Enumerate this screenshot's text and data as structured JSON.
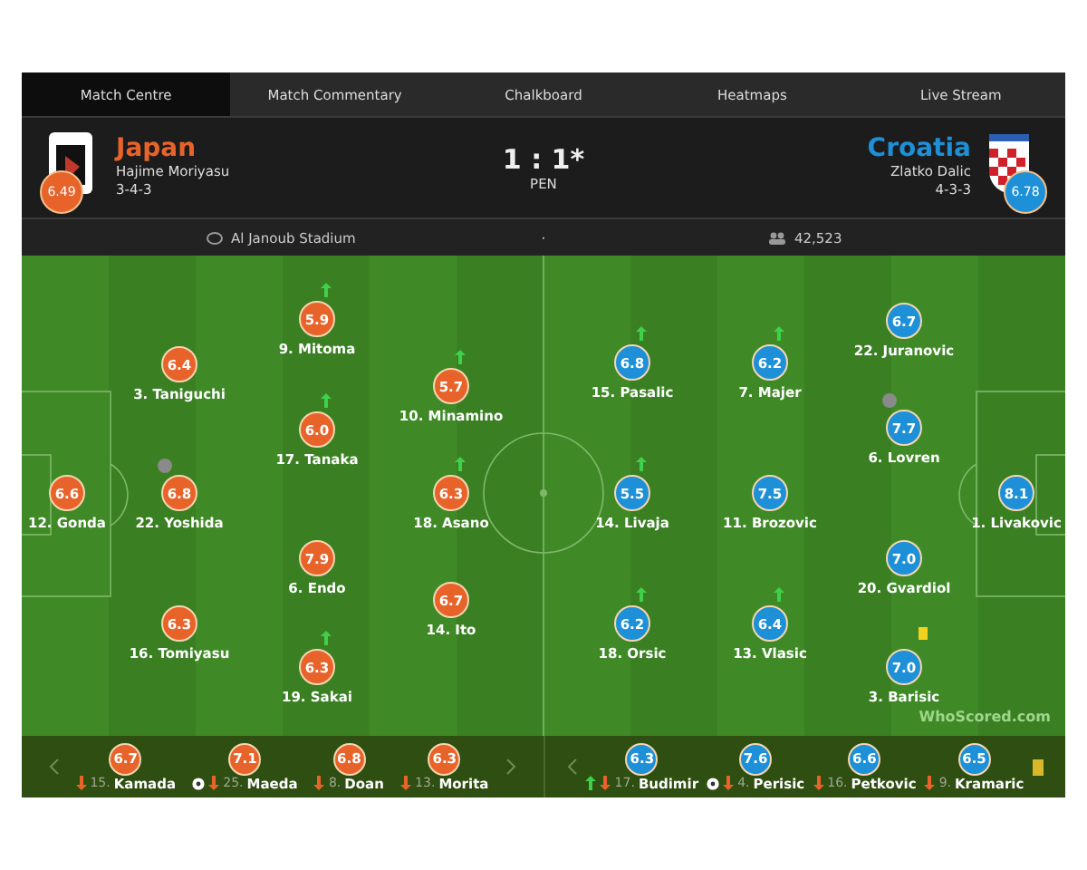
{
  "tabs": [
    {
      "label": "Match Centre",
      "selected": true
    },
    {
      "label": "Match Commentary",
      "selected": false
    },
    {
      "label": "Chalkboard",
      "selected": false
    },
    {
      "label": "Heatmaps",
      "selected": false
    },
    {
      "label": "Live Stream",
      "selected": false
    }
  ],
  "home": {
    "name": "Japan",
    "manager": "Hajime Moriyasu",
    "formation": "3-4-3",
    "rating": "6.49",
    "color": "#e8632a"
  },
  "away": {
    "name": "Croatia",
    "manager": "Zlatko Dalic",
    "formation": "4-3-3",
    "rating": "6.78",
    "color": "#1e90d8"
  },
  "score": "1 : 1*",
  "score_note": "PEN",
  "info": {
    "stadium": "Al Janoub Stadium",
    "separator": "·",
    "attendance": "42,523"
  },
  "home_players": [
    {
      "label": "12. Gonda",
      "rating": "6.6",
      "sub_on": false,
      "captain": false,
      "yellow_card": false
    },
    {
      "label": "3. Taniguchi",
      "rating": "6.4",
      "sub_on": false,
      "captain": false,
      "yellow_card": false
    },
    {
      "label": "22. Yoshida",
      "rating": "6.8",
      "sub_on": false,
      "captain": true,
      "yellow_card": false
    },
    {
      "label": "16. Tomiyasu",
      "rating": "6.3",
      "sub_on": false,
      "captain": false,
      "yellow_card": false
    },
    {
      "label": "9. Mitoma",
      "rating": "5.9",
      "sub_on": true,
      "captain": false,
      "yellow_card": false
    },
    {
      "label": "17. Tanaka",
      "rating": "6.0",
      "sub_on": true,
      "captain": false,
      "yellow_card": false
    },
    {
      "label": "6. Endo",
      "rating": "7.9",
      "sub_on": false,
      "captain": false,
      "yellow_card": false
    },
    {
      "label": "19. Sakai",
      "rating": "6.3",
      "sub_on": true,
      "captain": false,
      "yellow_card": false
    },
    {
      "label": "10. Minamino",
      "rating": "5.7",
      "sub_on": true,
      "captain": false,
      "yellow_card": false
    },
    {
      "label": "18. Asano",
      "rating": "6.3",
      "sub_on": true,
      "captain": false,
      "yellow_card": false
    },
    {
      "label": "14. Ito",
      "rating": "6.7",
      "sub_on": false,
      "captain": false,
      "yellow_card": false
    }
  ],
  "away_players": [
    {
      "label": "15. Pasalic",
      "rating": "6.8",
      "sub_on": true,
      "captain": false,
      "yellow_card": false
    },
    {
      "label": "7. Majer",
      "rating": "6.2",
      "sub_on": true,
      "captain": false,
      "yellow_card": false
    },
    {
      "label": "22. Juranovic",
      "rating": "6.7",
      "sub_on": false,
      "captain": false,
      "yellow_card": false
    },
    {
      "label": "6. Lovren",
      "rating": "7.7",
      "sub_on": false,
      "captain": true,
      "yellow_card": false
    },
    {
      "label": "14. Livaja",
      "rating": "5.5",
      "sub_on": true,
      "captain": false,
      "yellow_card": false
    },
    {
      "label": "11. Brozovic",
      "rating": "7.5",
      "sub_on": false,
      "captain": false,
      "yellow_card": false
    },
    {
      "label": "1. Livakovic",
      "rating": "8.1",
      "sub_on": false,
      "captain": false,
      "yellow_card": false
    },
    {
      "label": "20. Gvardiol",
      "rating": "7.0",
      "sub_on": false,
      "captain": false,
      "yellow_card": false
    },
    {
      "label": "18. Orsic",
      "rating": "6.2",
      "sub_on": true,
      "captain": false,
      "yellow_card": false
    },
    {
      "label": "13. Vlasic",
      "rating": "6.4",
      "sub_on": true,
      "captain": false,
      "yellow_card": false
    },
    {
      "label": "3. Barisic",
      "rating": "7.0",
      "sub_on": false,
      "captain": false,
      "yellow_card": true
    }
  ],
  "watermark_logo": "WhoScored.com",
  "home_bench": [
    {
      "number": "15.",
      "name": "Kamada",
      "rating": "6.7",
      "sub_on": false,
      "goal": false
    },
    {
      "number": "25.",
      "name": "Maeda",
      "rating": "7.1",
      "sub_on": false,
      "goal": true
    },
    {
      "number": "8.",
      "name": "Doan",
      "rating": "6.8",
      "sub_on": false,
      "goal": false
    },
    {
      "number": "13.",
      "name": "Morita",
      "rating": "6.3",
      "sub_on": false,
      "goal": false
    }
  ],
  "away_bench": [
    {
      "number": "17.",
      "name": "Budimir",
      "rating": "6.3",
      "sub_on": true,
      "goal": false
    },
    {
      "number": "4.",
      "name": "Perisic",
      "rating": "7.6",
      "sub_on": false,
      "goal": true
    },
    {
      "number": "16.",
      "name": "Petkovic",
      "rating": "6.6",
      "sub_on": false,
      "goal": false
    },
    {
      "number": "9.",
      "name": "Kramaric",
      "rating": "6.5",
      "sub_on": false,
      "goal": false
    }
  ],
  "away_bench_yellow_card": true
}
